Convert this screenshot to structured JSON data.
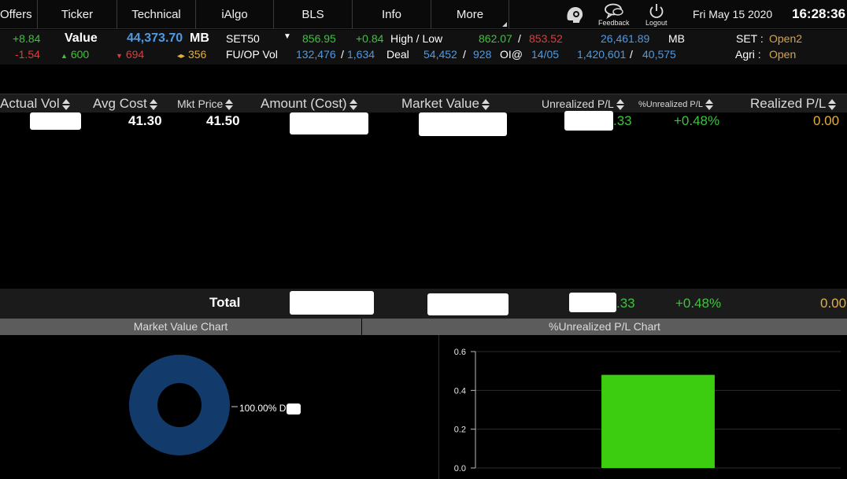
{
  "nav": {
    "tabs": [
      "Offers",
      "Ticker",
      "Technical",
      "iAlgo",
      "BLS",
      "Info",
      "More"
    ],
    "feedback_label": "Feedback",
    "logout_label": "Logout",
    "date": "Fri May 15 2020",
    "time": "16:28:36"
  },
  "market": {
    "change_up": "+8.84",
    "change_down": "-1.54",
    "value_label": "Value",
    "value": "44,373.70",
    "value_unit": "MB",
    "adv": "600",
    "dec": "694",
    "unch": "356",
    "index_name": "SET50",
    "index_value": "856.95",
    "index_change": "+0.84",
    "high_low_label": "High / Low",
    "high": "862.07",
    "hl_sep": "/",
    "low": "853.52",
    "index_turnover": "26,461.89",
    "index_turnover_unit": "MB",
    "set_label": "SET :",
    "set_status": "Open2",
    "fu_op_label": "FU/OP Vol",
    "fu_op_vol": "132,476",
    "fu_op_sep": "/",
    "fu_op_vol2": "1,634",
    "deal_label": "Deal",
    "deal": "54,452",
    "deal_sep": "/",
    "deal2": "928",
    "oi_label": "OI@",
    "oi_date": "14/05",
    "oi": "1,420,601",
    "oi_sep": "/",
    "oi2": "40,575",
    "agri_label": "Agri :",
    "agri_status": "Open"
  },
  "table": {
    "columns": [
      "Actual Vol",
      "Avg Cost",
      "Mkt Price",
      "Amount (Cost)",
      "Market Value",
      "Unrealized P/L",
      "%Unrealized P/L",
      "Realized P/L"
    ],
    "rows": [
      {
        "avg_cost": "41.30",
        "mkt_price": "41.50",
        "unrealized_suffix": ".33",
        "pct_unrealized": "+0.48%",
        "realized": "0.00"
      }
    ]
  },
  "total": {
    "label": "Total",
    "unrealized_suffix": ".33",
    "pct_unrealized": "+0.48%",
    "realized": "0.00"
  },
  "charts": {
    "market_value_title": "Market Value Chart",
    "unrealized_title": "%Unrealized P/L Chart",
    "donut_label": "100.00% D"
  },
  "colors": {
    "positive": "#3cc43c",
    "negative": "#e23b3b",
    "blue": "#4d9be6",
    "status": "#d9a34a",
    "donut": "#123a6b",
    "bar": "#3ccc10"
  },
  "chart_data": [
    {
      "type": "pie",
      "title": "Market Value Chart",
      "categories": [
        "D"
      ],
      "values": [
        100.0
      ]
    },
    {
      "type": "bar",
      "title": "%Unrealized P/L Chart",
      "categories": [
        ""
      ],
      "values": [
        0.48
      ],
      "ylim": [
        0,
        0.6
      ],
      "yticks": [
        "0.0",
        "0.2",
        "0.4",
        "0.6"
      ]
    }
  ]
}
